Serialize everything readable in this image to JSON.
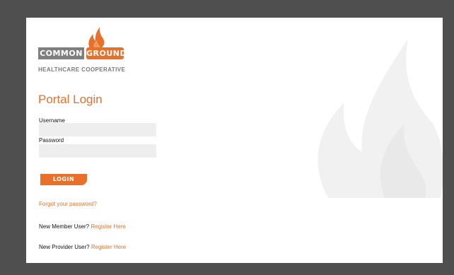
{
  "logo": {
    "word1": "COMMON",
    "word2": "GROUND",
    "subtitle": "HEALTHCARE COOPERATIVE"
  },
  "login": {
    "title": "Portal Login",
    "username_label": "Username",
    "username_value": "",
    "password_label": "Password",
    "password_value": "",
    "button_label": "LOGIN",
    "forgot_link": "Forgot your password?"
  },
  "register": {
    "member_prompt": "New Member User?",
    "member_link": "Register Here",
    "provider_prompt": "New Provider User?",
    "provider_link": "Register Here"
  },
  "colors": {
    "accent": "#e8702a",
    "frame": "#4f4f4f",
    "input_bg": "#eeeeee",
    "logo_gray": "#7f7f7f"
  },
  "icons": {
    "logo_mark": "flame-icon",
    "background": "flame-watermark"
  }
}
